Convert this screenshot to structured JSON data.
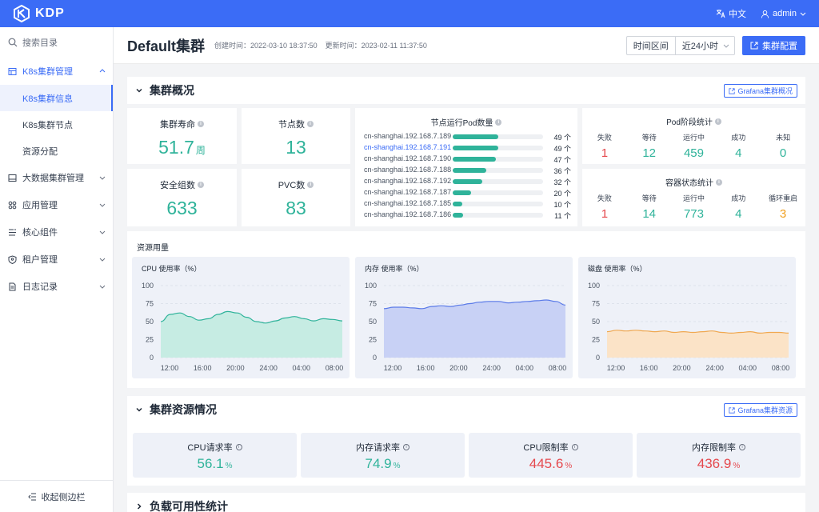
{
  "app": {
    "logo_text": "KDP",
    "lang_label": "中文",
    "user_label": "admin"
  },
  "sidebar": {
    "search_placeholder": "搜索目录",
    "groups": [
      {
        "label": "K8s集群管理",
        "icon": "cluster-icon",
        "expanded": true,
        "items": [
          {
            "label": "K8s集群信息",
            "active": true
          },
          {
            "label": "K8s集群节点"
          },
          {
            "label": "资源分配"
          }
        ]
      },
      {
        "label": "大数据集群管理",
        "icon": "bigdata-icon"
      },
      {
        "label": "应用管理",
        "icon": "apps-icon"
      },
      {
        "label": "核心组件",
        "icon": "components-icon"
      },
      {
        "label": "租户管理",
        "icon": "tenant-icon"
      },
      {
        "label": "日志记录",
        "icon": "log-icon"
      }
    ],
    "collapse_label": "收起侧边栏"
  },
  "header": {
    "title": "Default集群",
    "created": "创建时间：2022-03-10 18:37:50",
    "updated": "更新时间：2023-02-11 11:37:50",
    "time_range_label": "时间区间",
    "time_range_value": "近24小时",
    "config_button": "集群配置"
  },
  "overview": {
    "title": "集群概况",
    "grafana_link": "Grafana集群概况",
    "stats": [
      {
        "label": "集群寿命",
        "value": "51.7",
        "unit": "周"
      },
      {
        "label": "节点数",
        "value": "13",
        "unit": ""
      },
      {
        "label": "安全组数",
        "value": "633",
        "unit": ""
      },
      {
        "label": "PVC数",
        "value": "83",
        "unit": ""
      }
    ],
    "pods_per_node": {
      "title": "节点运行Pod数量",
      "rows": [
        {
          "node": "cn-shanghai.192.168.7.189",
          "count": "49 个",
          "value": 49
        },
        {
          "node": "cn-shanghai.192.168.7.191",
          "count": "49 个",
          "value": 49,
          "hovered": true
        },
        {
          "node": "cn-shanghai.192.168.7.190",
          "count": "47 个",
          "value": 47
        },
        {
          "node": "cn-shanghai.192.168.7.188",
          "count": "36 个",
          "value": 36
        },
        {
          "node": "cn-shanghai.192.168.7.192",
          "count": "32 个",
          "value": 32
        },
        {
          "node": "cn-shanghai.192.168.7.187",
          "count": "20 个",
          "value": 20
        },
        {
          "node": "cn-shanghai.192.168.7.185",
          "count": "10 个",
          "value": 10
        },
        {
          "node": "cn-shanghai.192.168.7.186",
          "count": "11 个",
          "value": 11
        }
      ]
    },
    "pod_phase": {
      "title": "Pod阶段统计",
      "items": [
        {
          "label": "失败",
          "value": "1",
          "color": "#e5484d"
        },
        {
          "label": "等待",
          "value": "12",
          "color": "#2fb39a"
        },
        {
          "label": "运行中",
          "value": "459",
          "color": "#2fb39a"
        },
        {
          "label": "成功",
          "value": "4",
          "color": "#2fb39a"
        },
        {
          "label": "未知",
          "value": "0",
          "color": "#2fb39a"
        }
      ]
    },
    "container_status": {
      "title": "容器状态统计",
      "items": [
        {
          "label": "失败",
          "value": "1",
          "color": "#e5484d"
        },
        {
          "label": "等待",
          "value": "14",
          "color": "#2fb39a"
        },
        {
          "label": "运行中",
          "value": "773",
          "color": "#2fb39a"
        },
        {
          "label": "成功",
          "value": "4",
          "color": "#2fb39a"
        },
        {
          "label": "循环重启",
          "value": "3",
          "color": "#f0a020"
        }
      ]
    }
  },
  "usage": {
    "title": "资源用量"
  },
  "chart_data": [
    {
      "type": "area",
      "title": "CPU 使用率（%）",
      "x": [
        "12:00",
        "16:00",
        "20:00",
        "24:00",
        "04:00",
        "08:00"
      ],
      "yticks": [
        "100",
        "75",
        "50",
        "25",
        "0"
      ],
      "ylim": [
        0,
        100
      ],
      "values": [
        50,
        60,
        62,
        57,
        52,
        54,
        60,
        64,
        62,
        56,
        50,
        48,
        51,
        55,
        57,
        54,
        51,
        54,
        53,
        51
      ],
      "color": "#2fb39a",
      "fill": "#c6ece3"
    },
    {
      "type": "area",
      "title": "内存 使用率（%）",
      "x": [
        "12:00",
        "16:00",
        "20:00",
        "24:00",
        "04:00",
        "08:00"
      ],
      "yticks": [
        "100",
        "75",
        "50",
        "25",
        "0"
      ],
      "ylim": [
        0,
        100
      ],
      "values": [
        68,
        70,
        70,
        69,
        68,
        71,
        72,
        71,
        73,
        75,
        77,
        78,
        78,
        76,
        77,
        78,
        79,
        80,
        78,
        73
      ],
      "color": "#5b7be8",
      "fill": "#c8d1f5"
    },
    {
      "type": "area",
      "title": "磁盘 使用率（%）",
      "x": [
        "12:00",
        "16:00",
        "20:00",
        "24:00",
        "04:00",
        "08:00"
      ],
      "yticks": [
        "100",
        "75",
        "50",
        "25",
        "0"
      ],
      "ylim": [
        0,
        100
      ],
      "values": [
        36,
        38,
        37,
        38,
        37,
        36,
        37,
        35,
        36,
        35,
        36,
        37,
        35,
        34,
        35,
        36,
        34,
        35,
        35,
        34
      ],
      "color": "#f0a850",
      "fill": "#fbe3c7"
    }
  ],
  "resources": {
    "title": "集群资源情况",
    "grafana_link": "Grafana集群资源",
    "rates": [
      {
        "label": "CPU请求率",
        "value": "56.1",
        "unit": "%",
        "color": "#2fb39a"
      },
      {
        "label": "内存请求率",
        "value": "74.9",
        "unit": "%",
        "color": "#2fb39a"
      },
      {
        "label": "CPU限制率",
        "value": "445.6",
        "unit": "%",
        "color": "#e5484d"
      },
      {
        "label": "内存限制率",
        "value": "436.9",
        "unit": "%",
        "color": "#e5484d"
      }
    ]
  },
  "availability": {
    "title": "负载可用性统计"
  }
}
